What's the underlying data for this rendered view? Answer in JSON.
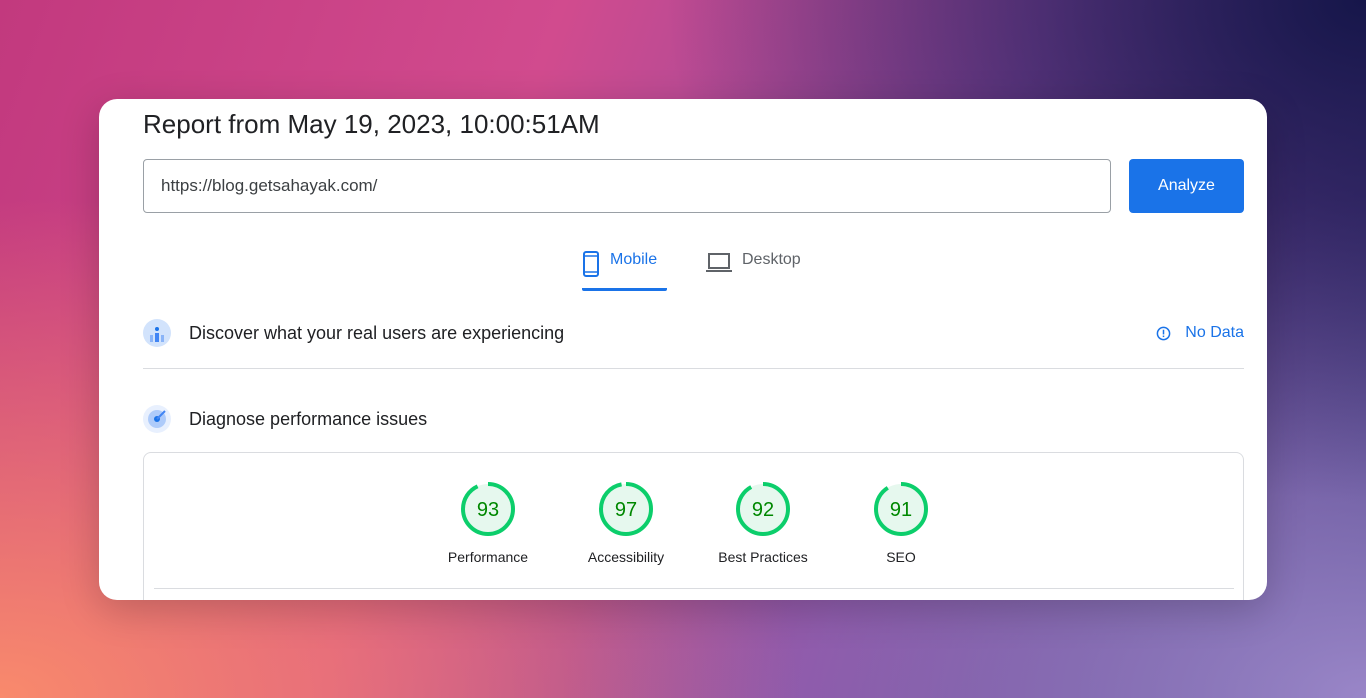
{
  "report": {
    "title": "Report from May 19, 2023, 10:00:51AM"
  },
  "url_input": {
    "value": "https://blog.getsahayak.com/"
  },
  "analyze_label": "Analyze",
  "tabs": [
    {
      "label": "Mobile",
      "icon": "smartphone-icon",
      "selected": true
    },
    {
      "label": "Desktop",
      "icon": "laptop-icon",
      "selected": false
    }
  ],
  "sections": {
    "real_users": "Discover what your real users are experiencing",
    "no_data": "No Data",
    "diagnose": "Diagnose performance issues"
  },
  "scores": [
    {
      "label": "Performance",
      "value": "93"
    },
    {
      "label": "Accessibility",
      "value": "97"
    },
    {
      "label": "Best Practices",
      "value": "92"
    },
    {
      "label": "SEO",
      "value": "91"
    }
  ],
  "colors": {
    "accent": "#1a73e8",
    "pass": "#0cce6b",
    "pass_text": "#008800",
    "pass_fill": "#e6f8ee"
  }
}
